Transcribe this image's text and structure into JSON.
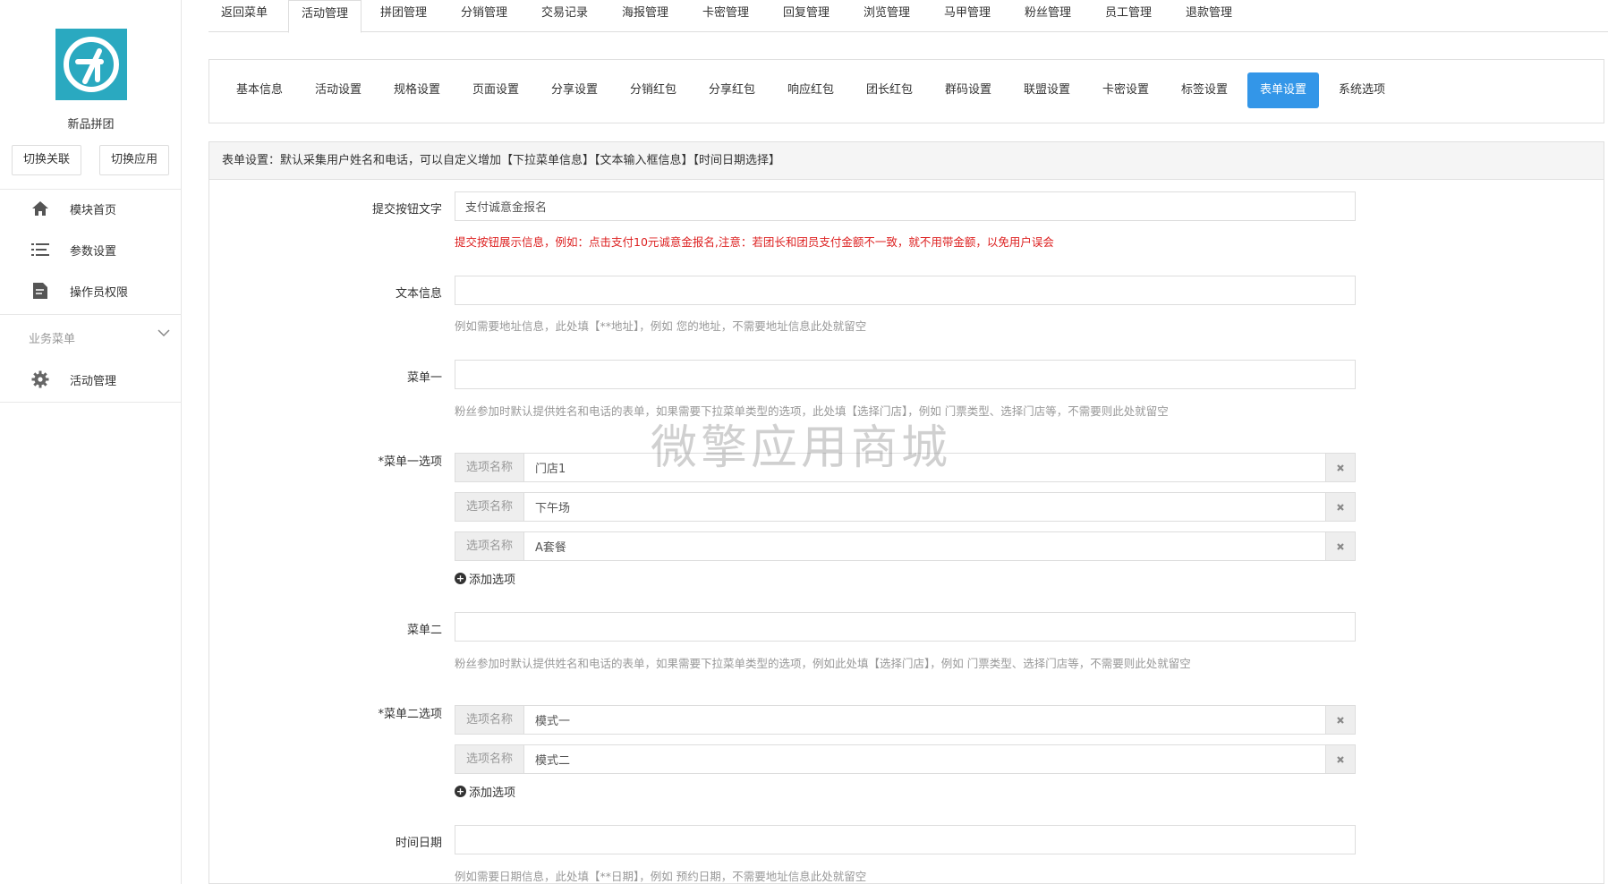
{
  "sidebar": {
    "app_name": "新品拼团",
    "switch_buttons": [
      "切换关联",
      "切换应用"
    ],
    "menu": [
      {
        "label": "模块首页",
        "icon": "home-icon"
      },
      {
        "label": "参数设置",
        "icon": "list-icon"
      },
      {
        "label": "操作员权限",
        "icon": "document-icon"
      }
    ],
    "group_title": "业务菜单",
    "group_items": [
      {
        "label": "活动管理",
        "icon": "gear-icon"
      }
    ]
  },
  "top_tabs": [
    "返回菜单",
    "活动管理",
    "拼团管理",
    "分销管理",
    "交易记录",
    "海报管理",
    "卡密管理",
    "回复管理",
    "浏览管理",
    "马甲管理",
    "粉丝管理",
    "员工管理",
    "退款管理"
  ],
  "top_tabs_active": "活动管理",
  "sub_tabs": [
    "基本信息",
    "活动设置",
    "规格设置",
    "页面设置",
    "分享设置",
    "分销红包",
    "分享红包",
    "响应红包",
    "团长红包",
    "群码设置",
    "联盟设置",
    "卡密设置",
    "标签设置",
    "表单设置",
    "系统选项"
  ],
  "sub_tabs_active": "表单设置",
  "colors": {
    "accent": "#3396e8",
    "warning_text": "#dd2222",
    "logo_bg": "#2aa9c0"
  },
  "panel": {
    "heading": "表单设置：默认采集用户姓名和电话，可以自定义增加【下拉菜单信息】【文本输入框信息】【时间日期选择】",
    "submit": {
      "label": "提交按钮文字",
      "value": "支付诚意金报名",
      "help": "提交按钮展示信息，例如：点击支付10元诚意金报名,注意：若团长和团员支付金额不一致，就不用带金额，以免用户误会"
    },
    "text_info": {
      "label": "文本信息",
      "value": "",
      "help": "例如需要地址信息，此处填【**地址】，例如 您的地址，不需要地址信息此处就留空"
    },
    "menu1": {
      "label": "菜单一",
      "value": "",
      "help": "粉丝参加时默认提供姓名和电话的表单，如果需要下拉菜单类型的选项，此处填【选择门店】，例如 门票类型、选择门店等，不需要则此处就留空"
    },
    "menu1_options": {
      "label": "*菜单一选项",
      "addon": "选项名称",
      "items": [
        "门店1",
        "下午场",
        "A套餐"
      ],
      "add_label": "添加选项"
    },
    "menu2": {
      "label": "菜单二",
      "value": "",
      "help": "粉丝参加时默认提供姓名和电话的表单，如果需要下拉菜单类型的选项，例如此处填【选择门店】，例如 门票类型、选择门店等，不需要则此处就留空"
    },
    "menu2_options": {
      "label": "*菜单二选项",
      "addon": "选项名称",
      "items": [
        "模式一",
        "模式二"
      ],
      "add_label": "添加选项"
    },
    "datetime": {
      "label": "时间日期",
      "value": "",
      "help": "例如需要日期信息，此处填【**日期】，例如 预约日期，不需要地址信息此处就留空"
    }
  },
  "watermark": "微擎应用商城"
}
